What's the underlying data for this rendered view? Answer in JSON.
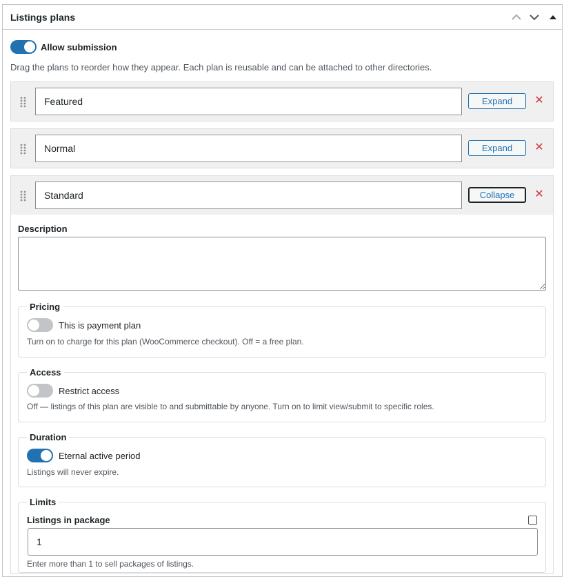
{
  "panel": {
    "title": "Listings plans",
    "controls": {
      "move_up_icon": "chevron-up-icon",
      "move_down_icon": "chevron-down-icon",
      "toggle_icon": "triangle-up-icon"
    }
  },
  "allow_submission": {
    "label": "Allow submission",
    "enabled": true
  },
  "intro_text": "Drag the plans to reorder how they appear. Each plan is reusable and can be attached to other directories.",
  "plans": [
    {
      "name": "Featured",
      "button_label": "Expand",
      "remove_icon": "close-icon"
    },
    {
      "name": "Normal",
      "button_label": "Expand",
      "remove_icon": "close-icon"
    },
    {
      "name": "Standard",
      "button_label": "Collapse",
      "remove_icon": "close-icon"
    }
  ],
  "expanded_plan": {
    "description": {
      "label": "Description",
      "value": ""
    },
    "pricing": {
      "legend": "Pricing",
      "toggle_label": "This is payment plan",
      "enabled": false,
      "help": "Turn on to charge for this plan (WooCommerce checkout). Off = a free plan."
    },
    "access": {
      "legend": "Access",
      "toggle_label": "Restrict access",
      "enabled": false,
      "help": "Off — listings of this plan are visible to and submittable by anyone. Turn on to limit view/submit to specific roles."
    },
    "duration": {
      "legend": "Duration",
      "toggle_label": "Eternal active period",
      "enabled": true,
      "help": "Listings will never expire."
    },
    "limits": {
      "legend": "Limits",
      "listings_label": "Listings in package",
      "listings_value": "1",
      "checkbox_checked": false,
      "help": "Enter more than 1 to sell packages of listings."
    }
  },
  "colors": {
    "accent": "#2271b1",
    "remove": "#d63638",
    "border": "#c3c4c7",
    "row_bg": "#f0f0f1"
  }
}
